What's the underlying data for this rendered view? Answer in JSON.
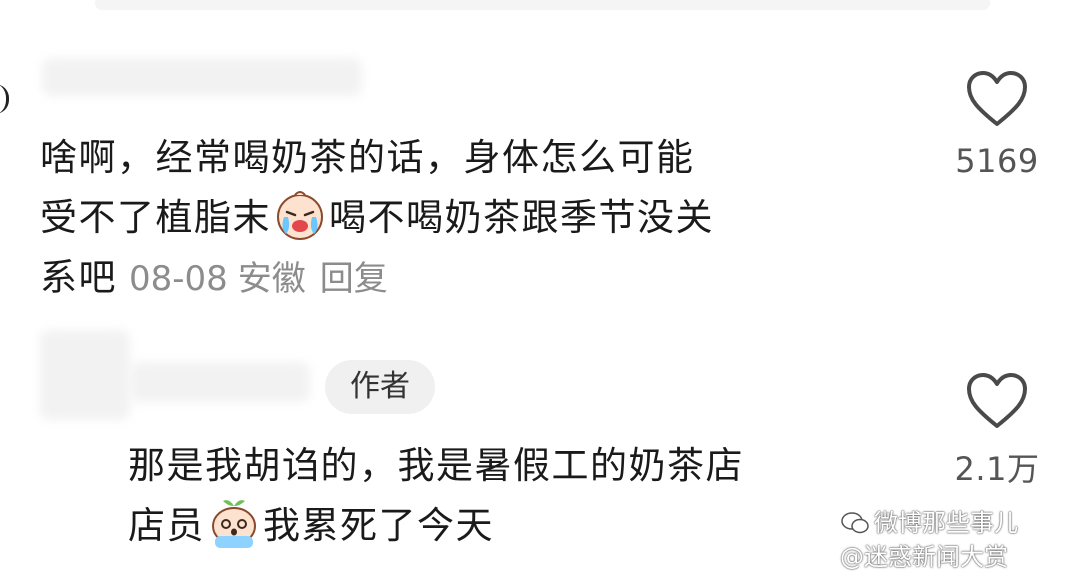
{
  "comment1": {
    "text_part1": "啥啊，经常喝奶茶的话，身体怎么可能",
    "text_part2": "受不了植脂末",
    "emoji": "crying-face-emoji",
    "text_part3": "喝不喝奶茶跟季节没关",
    "text_part4": "系吧",
    "date": "08-08",
    "location": "安徽",
    "reply_label": "回复",
    "like_count": "5169"
  },
  "comment2": {
    "author_badge": "作者",
    "text_part1": "那是我胡诌的，我是暑假工的奶茶店",
    "text_part2": "店员",
    "emoji": "crying-sprout-emoji",
    "text_part3": "我累死了今天",
    "like_count": "2.1万"
  },
  "watermark": {
    "line1": "微博那些事儿",
    "line2": "@迷惑新闻大赏"
  },
  "icons": {
    "like": "heart-outline-icon",
    "watermark": "wechat-icon"
  },
  "colors": {
    "text": "#1a1a1a",
    "meta": "#8c8c8c",
    "badge_bg": "#f0f0f0"
  }
}
